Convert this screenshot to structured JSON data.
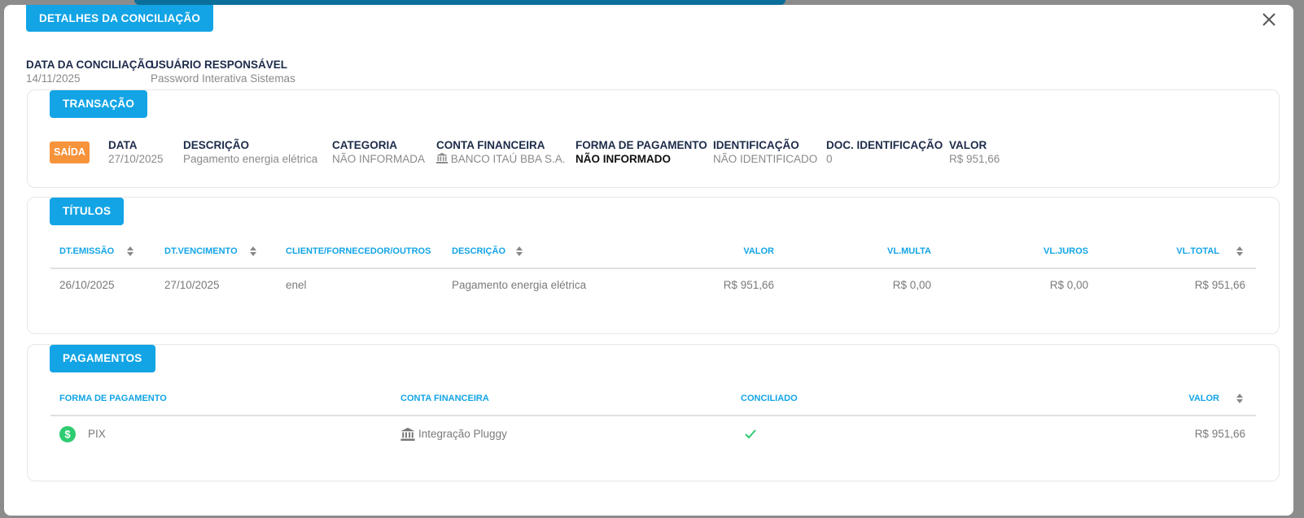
{
  "modal": {
    "title": "DETALHES DA CONCILIAÇÃO",
    "date_label": "DATA DA CONCILIAÇÃO",
    "date_value": "14/11/2025",
    "user_label": "USUÁRIO RESPONSÁVEL",
    "user_value": "Password Interativa Sistemas"
  },
  "transaction": {
    "section_title": "TRANSAÇÃO",
    "type_badge": "SAÍDA",
    "fields": {
      "data_label": "DATA",
      "data_value": "27/10/2025",
      "descricao_label": "DESCRIÇÃO",
      "descricao_value": "Pagamento energia elétrica",
      "categoria_label": "CATEGORIA",
      "categoria_value": "NÃO INFORMADA",
      "conta_label": "CONTA FINANCEIRA",
      "conta_value": "BANCO ITAÚ BBA S.A.",
      "forma_label": "FORMA DE PAGAMENTO",
      "forma_value": "NÃO INFORMADO",
      "ident_label": "IDENTIFICAÇÃO",
      "ident_value": "NÃO IDENTIFICADO",
      "docident_label": "DOC. IDENTIFICAÇÃO",
      "docident_value": "0",
      "valor_label": "VALOR",
      "valor_value": "R$ 951,66"
    }
  },
  "titulos": {
    "section_title": "TÍTULOS",
    "columns": [
      "DT.EMISSÃO",
      "DT.VENCIMENTO",
      "CLIENTE/FORNECEDOR/OUTROS",
      "DESCRIÇÃO",
      "VALOR",
      "VL.MULTA",
      "VL.JUROS",
      "VL.TOTAL"
    ],
    "rows": [
      [
        "26/10/2025",
        "27/10/2025",
        "enel",
        "Pagamento energia elétrica",
        "R$ 951,66",
        "R$ 0,00",
        "R$ 0,00",
        "R$ 951,66"
      ]
    ]
  },
  "pagamentos": {
    "section_title": "PAGAMENTOS",
    "columns": [
      "FORMA DE PAGAMENTO",
      "CONTA FINANCEIRA",
      "CONCILIADO",
      "VALOR"
    ],
    "rows": [
      {
        "forma": "PIX",
        "conta": "Integração Pluggy",
        "conciliado": true,
        "valor": "R$ 951,66"
      }
    ]
  },
  "colors": {
    "accent": "#12a4e5",
    "out_badge": "#f7933b",
    "success": "#2ecc71",
    "label_dark": "#1d2b4a"
  },
  "icons": [
    "close-icon",
    "bank-icon",
    "sort-icon",
    "dollar-circle-icon",
    "check-icon"
  ]
}
